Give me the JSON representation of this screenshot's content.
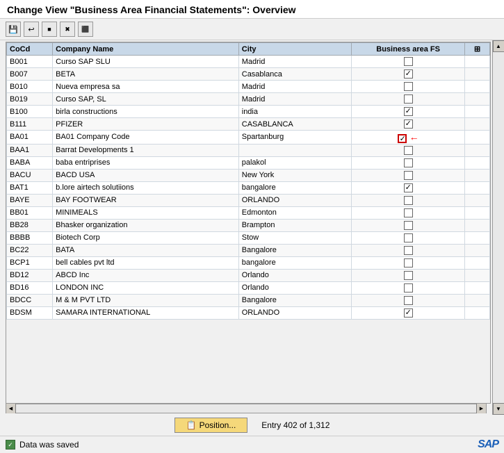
{
  "title": "Change View \"Business Area Financial Statements\": Overview",
  "toolbar": {
    "buttons": [
      {
        "name": "save-btn",
        "icon": "💾",
        "label": "Save"
      },
      {
        "name": "back-btn",
        "icon": "↩",
        "label": "Back"
      },
      {
        "name": "exit-btn",
        "icon": "🚪",
        "label": "Exit"
      },
      {
        "name": "cancel-btn",
        "icon": "🔴",
        "label": "Cancel"
      },
      {
        "name": "print-btn",
        "icon": "🖨",
        "label": "Print"
      }
    ]
  },
  "table": {
    "columns": [
      {
        "key": "cocd",
        "label": "CoCd"
      },
      {
        "key": "name",
        "label": "Company Name"
      },
      {
        "key": "city",
        "label": "City"
      },
      {
        "key": "ba_fs",
        "label": "Business area FS"
      }
    ],
    "rows": [
      {
        "cocd": "B001",
        "name": "Curso SAP SLU",
        "city": "Madrid",
        "checked": false,
        "red_border": false
      },
      {
        "cocd": "B007",
        "name": "BETA",
        "city": "Casablanca",
        "checked": true,
        "red_border": false
      },
      {
        "cocd": "B010",
        "name": "Nueva empresa sa",
        "city": "Madrid",
        "checked": false,
        "red_border": false
      },
      {
        "cocd": "B019",
        "name": "Curso SAP, SL",
        "city": "Madrid",
        "checked": false,
        "red_border": false
      },
      {
        "cocd": "B100",
        "name": "birla constructions",
        "city": "india",
        "checked": true,
        "red_border": false
      },
      {
        "cocd": "B111",
        "name": "PFIZER",
        "city": "CASABLANCA",
        "checked": true,
        "red_border": false
      },
      {
        "cocd": "BA01",
        "name": "BA01 Company Code",
        "city": "Spartanburg",
        "checked": true,
        "red_border": true,
        "has_arrow": true
      },
      {
        "cocd": "BAA1",
        "name": "Barrat Developments 1",
        "city": "",
        "checked": false,
        "red_border": false
      },
      {
        "cocd": "BABA",
        "name": "baba entriprises",
        "city": "palakol",
        "checked": false,
        "red_border": false
      },
      {
        "cocd": "BACU",
        "name": "BACD USA",
        "city": "New York",
        "checked": false,
        "red_border": false
      },
      {
        "cocd": "BAT1",
        "name": "b.lore airtech solutiions",
        "city": "bangalore",
        "checked": true,
        "red_border": false
      },
      {
        "cocd": "BAYE",
        "name": "BAY FOOTWEAR",
        "city": "ORLANDO",
        "checked": false,
        "red_border": false
      },
      {
        "cocd": "BB01",
        "name": "MINIMEALS",
        "city": "Edmonton",
        "checked": false,
        "red_border": false
      },
      {
        "cocd": "BB28",
        "name": "Bhasker organization",
        "city": "Brampton",
        "checked": false,
        "red_border": false
      },
      {
        "cocd": "BBBB",
        "name": "Biotech Corp",
        "city": "Stow",
        "checked": false,
        "red_border": false
      },
      {
        "cocd": "BC22",
        "name": "BATA",
        "city": "Bangalore",
        "checked": false,
        "red_border": false
      },
      {
        "cocd": "BCP1",
        "name": "bell cables pvt ltd",
        "city": "bangalore",
        "checked": false,
        "red_border": false
      },
      {
        "cocd": "BD12",
        "name": "ABCD Inc",
        "city": "Orlando",
        "checked": false,
        "red_border": false
      },
      {
        "cocd": "BD16",
        "name": "LONDON INC",
        "city": "Orlando",
        "checked": false,
        "red_border": false
      },
      {
        "cocd": "BDCC",
        "name": "M & M PVT LTD",
        "city": "Bangalore",
        "checked": false,
        "red_border": false
      },
      {
        "cocd": "BDSM",
        "name": "SAMARA INTERNATIONAL",
        "city": "ORLANDO",
        "checked": true,
        "red_border": false
      }
    ]
  },
  "footer": {
    "position_btn": "Position...",
    "entry_info": "Entry 402 of 1,312"
  },
  "status": {
    "message": "Data was saved",
    "sap_logo": "SAP"
  }
}
